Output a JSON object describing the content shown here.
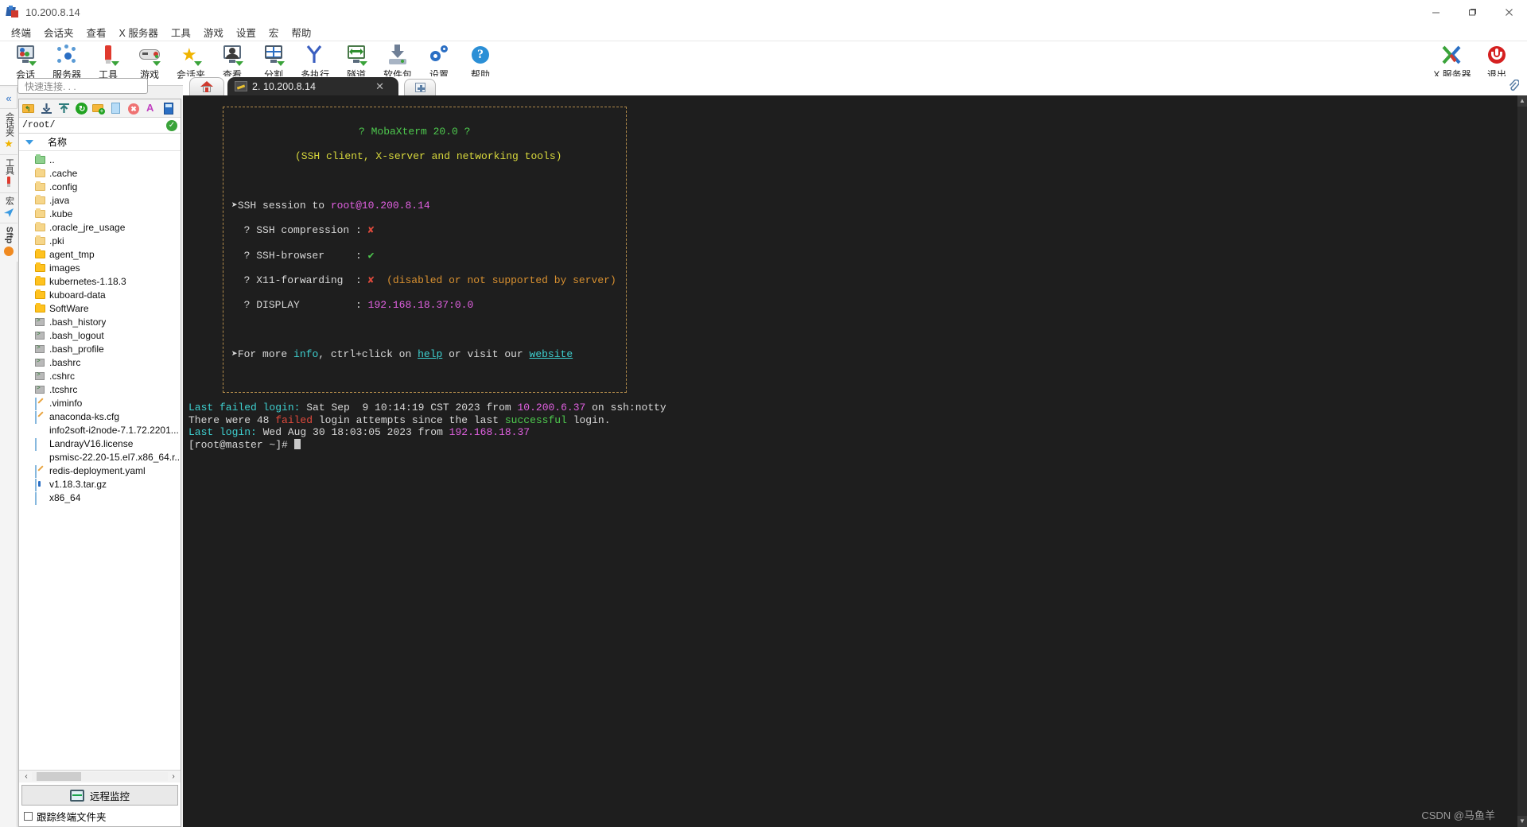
{
  "window": {
    "title": "10.200.8.14",
    "minimize_label": "—",
    "maximize_label": "❐",
    "close_label": "✕"
  },
  "menubar": {
    "items": [
      {
        "label": "终端"
      },
      {
        "label": "会话夹"
      },
      {
        "label": "查看"
      },
      {
        "label": "X 服务器"
      },
      {
        "label": "工具"
      },
      {
        "label": "游戏"
      },
      {
        "label": "设置"
      },
      {
        "label": "宏"
      },
      {
        "label": "帮助"
      }
    ]
  },
  "toolbar": {
    "items": [
      {
        "label": "会话",
        "icon": "session-icon"
      },
      {
        "label": "服务器",
        "icon": "servers-icon"
      },
      {
        "label": "工具",
        "icon": "tools-icon"
      },
      {
        "label": "游戏",
        "icon": "games-icon"
      },
      {
        "label": "会话夹",
        "icon": "sessions-folder-icon"
      },
      {
        "label": "查看",
        "icon": "view-icon"
      },
      {
        "label": "分割",
        "icon": "split-icon"
      },
      {
        "label": "多执行",
        "icon": "multiexec-icon"
      },
      {
        "label": "隧道",
        "icon": "tunneling-icon"
      },
      {
        "label": "软件包",
        "icon": "packages-icon"
      },
      {
        "label": "设置",
        "icon": "settings-icon"
      },
      {
        "label": "帮助",
        "icon": "help-icon"
      }
    ],
    "right_items": [
      {
        "label": "X 服务器",
        "icon": "xserver-icon"
      },
      {
        "label": "退出",
        "icon": "exit-icon"
      }
    ]
  },
  "quick_connect": {
    "placeholder": "快速连接. . ."
  },
  "vertical_tabs": {
    "collapse_label": "«",
    "items": [
      {
        "label": "会话夹",
        "icon": "star-icon"
      },
      {
        "label": "工具",
        "icon": "tools-icon"
      },
      {
        "label": "宏",
        "icon": "macro-icon"
      },
      {
        "label": "Sftp",
        "icon": "sftp-icon"
      }
    ]
  },
  "browser": {
    "toolbar_buttons": [
      {
        "name": "up-folder-icon"
      },
      {
        "name": "download-icon"
      },
      {
        "name": "upload-icon"
      },
      {
        "name": "refresh-icon"
      },
      {
        "name": "new-folder-icon"
      },
      {
        "name": "new-file-icon"
      },
      {
        "name": "delete-icon"
      },
      {
        "name": "text-mode-icon"
      },
      {
        "name": "binary-mode-icon"
      }
    ],
    "path": "/root/",
    "column_header": "名称",
    "files": [
      {
        "name": "..",
        "type": "parent"
      },
      {
        "name": ".cache",
        "type": "folder-light"
      },
      {
        "name": ".config",
        "type": "folder-light"
      },
      {
        "name": ".java",
        "type": "folder-light"
      },
      {
        "name": ".kube",
        "type": "folder-light"
      },
      {
        "name": ".oracle_jre_usage",
        "type": "folder-light"
      },
      {
        "name": ".pki",
        "type": "folder-light"
      },
      {
        "name": "agent_tmp",
        "type": "folder"
      },
      {
        "name": "images",
        "type": "folder"
      },
      {
        "name": "kubernetes-1.18.3",
        "type": "folder"
      },
      {
        "name": "kuboard-data",
        "type": "folder"
      },
      {
        "name": "SoftWare",
        "type": "folder"
      },
      {
        "name": ".bash_history",
        "type": "script"
      },
      {
        "name": ".bash_logout",
        "type": "script"
      },
      {
        "name": ".bash_profile",
        "type": "script"
      },
      {
        "name": ".bashrc",
        "type": "script"
      },
      {
        "name": ".cshrc",
        "type": "script"
      },
      {
        "name": ".tcshrc",
        "type": "script"
      },
      {
        "name": ".viminfo",
        "type": "edit"
      },
      {
        "name": "anaconda-ks.cfg",
        "type": "edit"
      },
      {
        "name": "info2soft-i2node-7.1.72.2201...",
        "type": "rpm"
      },
      {
        "name": "LandrayV16.license",
        "type": "plain"
      },
      {
        "name": "psmisc-22.20-15.el7.x86_64.r...",
        "type": "rpm"
      },
      {
        "name": "redis-deployment.yaml",
        "type": "edit"
      },
      {
        "name": "v1.18.3.tar.gz",
        "type": "archive"
      },
      {
        "name": "x86_64",
        "type": "plain"
      }
    ],
    "scroll_left_label": "‹",
    "scroll_right_label": "›",
    "remote_monitor_label": "远程监控",
    "follow_terminal_label": "跟踪终端文件夹"
  },
  "tabs": {
    "home_label": "",
    "active": {
      "label": "2. 10.200.8.14",
      "close_label": "✕"
    },
    "new_tab_label": ""
  },
  "terminal": {
    "banner": {
      "line1_title": "? MobaXterm 20.0 ?",
      "line2_subtitle": "(SSH client, X-server and networking tools)",
      "arrow": "➤",
      "session_prefix": "SSH session to ",
      "session_user": "root@",
      "session_host": "10.200.8.14",
      "rows": [
        {
          "key": "? SSH compression :",
          "value": "✘",
          "value_color": "red",
          "extra": ""
        },
        {
          "key": "? SSH-browser     :",
          "value": "✔",
          "value_color": "green",
          "extra": ""
        },
        {
          "key": "? X11-forwarding  :",
          "value": "✘",
          "value_color": "red",
          "extra": "(disabled or not supported by server)"
        },
        {
          "key": "? DISPLAY         :",
          "value": "192.168.18.37:0.0",
          "value_color": "magenta",
          "extra": ""
        }
      ],
      "footer_pre": "For more ",
      "footer_info": "info",
      "footer_mid": ", ctrl+click on ",
      "footer_help": "help",
      "footer_mid2": " or visit our ",
      "footer_website": "website"
    },
    "messages": {
      "last_failed_label": "Last failed login:",
      "last_failed_rest": " Sat Sep  9 10:14:19 CST 2023 from ",
      "last_failed_ip": "10.200.6.37",
      "last_failed_tail": " on ssh:notty",
      "attempts_pre": "There were 48 ",
      "attempts_failed": "failed",
      "attempts_mid": " login attempts since the last ",
      "attempts_success": "successful",
      "attempts_tail": " login.",
      "last_login_label": "Last login:",
      "last_login_rest": " Wed Aug 30 18:03:05 2023 from ",
      "last_login_ip": "192.168.18.37",
      "prompt": "[root@master ~]#"
    }
  },
  "watermark": {
    "text": "CSDN @马鱼羊"
  },
  "colors": {
    "terminal_bg": "#1e1e1e",
    "accent_blue": "#2b6fc4",
    "green": "#4ec94e",
    "magenta": "#e060e0",
    "red": "#e04a3c",
    "cyan": "#3ed0d0",
    "yellow": "#d8d83c"
  }
}
